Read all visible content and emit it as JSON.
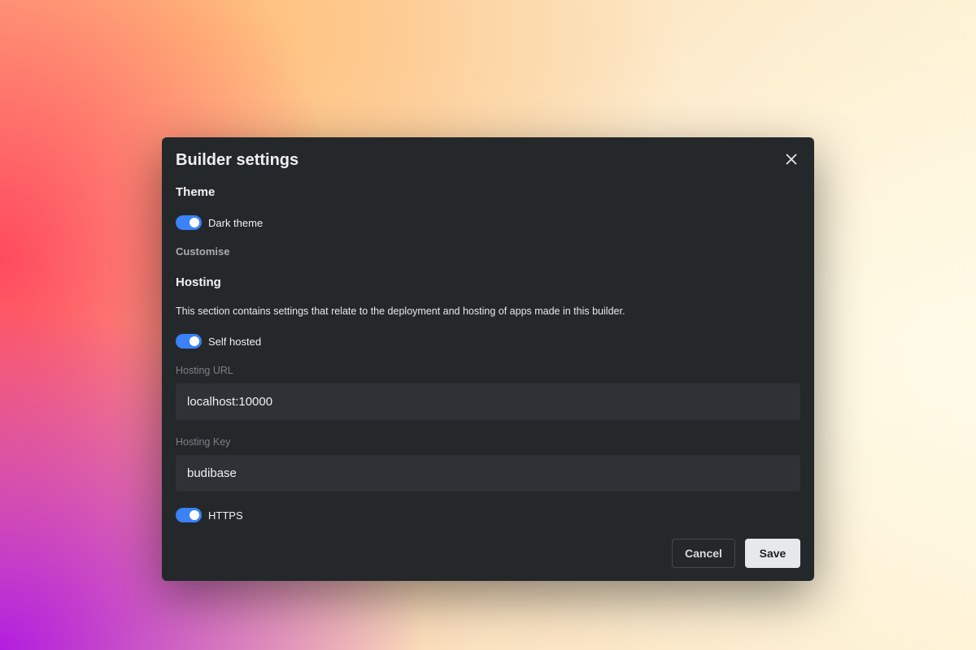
{
  "modal": {
    "title": "Builder settings",
    "close_icon": "close-icon"
  },
  "theme": {
    "heading": "Theme",
    "dark_theme": {
      "label": "Dark theme",
      "enabled": true
    },
    "customise_label": "Customise"
  },
  "hosting": {
    "heading": "Hosting",
    "description": "This section contains settings that relate to the deployment and hosting of apps made in this builder.",
    "self_hosted": {
      "label": "Self hosted",
      "enabled": true
    },
    "url": {
      "label": "Hosting URL",
      "value": "localhost:10000"
    },
    "key": {
      "label": "Hosting Key",
      "value": "budibase"
    },
    "https": {
      "label": "HTTPS",
      "enabled": true
    }
  },
  "actions": {
    "cancel_label": "Cancel",
    "save_label": "Save"
  },
  "colors": {
    "toggle_on": "#3b82f6",
    "modal_bg": "#24282b",
    "input_bg": "#2e3236"
  }
}
